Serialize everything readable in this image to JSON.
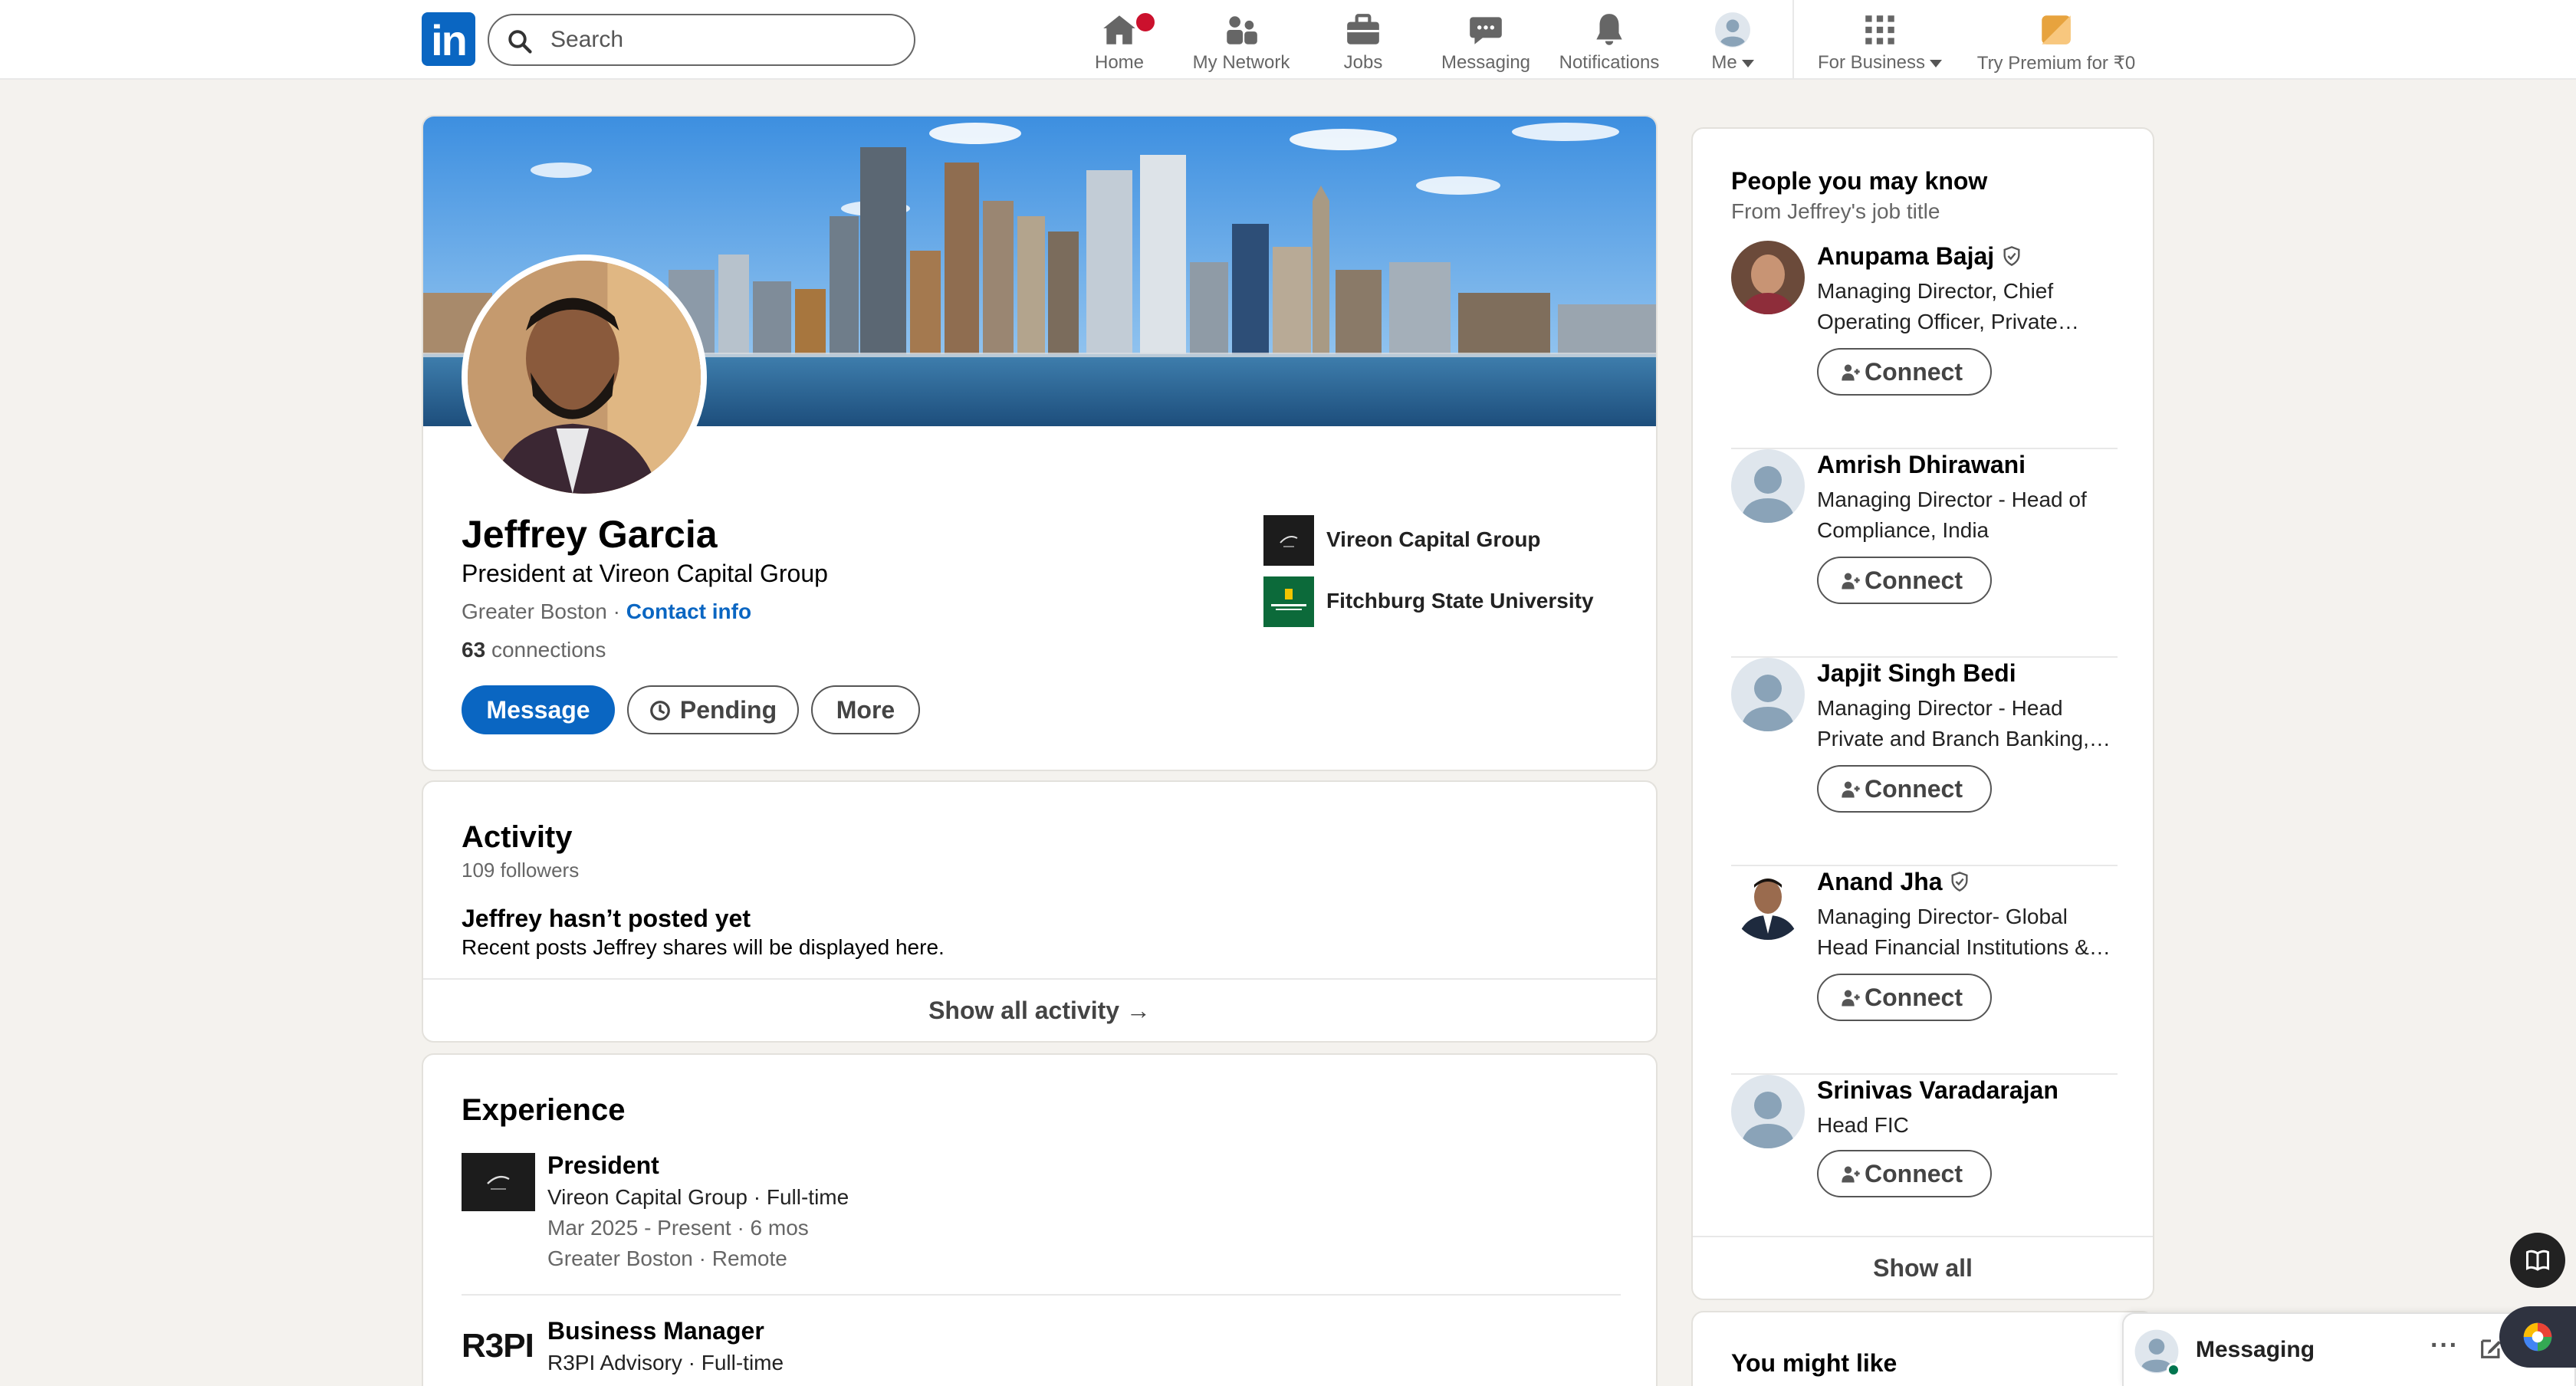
{
  "nav": {
    "logo": "in",
    "search_placeholder": "Search",
    "items": [
      {
        "label": "Home"
      },
      {
        "label": "My Network"
      },
      {
        "label": "Jobs"
      },
      {
        "label": "Messaging"
      },
      {
        "label": "Notifications"
      },
      {
        "label": "Me"
      },
      {
        "label": "For Business"
      },
      {
        "label": "Try Premium for ₹0"
      }
    ]
  },
  "profile": {
    "name": "Jeffrey Garcia",
    "headline": "President at Vireon Capital Group",
    "location": "Greater Boston",
    "separator": "·",
    "contact_info": "Contact info",
    "connections_count": "63",
    "connections_label": "connections",
    "buttons": {
      "message": "Message",
      "pending": "Pending",
      "more": "More"
    },
    "orgs": [
      {
        "name": "Vireon Capital Group"
      },
      {
        "name": "Fitchburg State University"
      }
    ]
  },
  "activity": {
    "title": "Activity",
    "followers": "109 followers",
    "empty_title": "Jeffrey hasn’t posted yet",
    "empty_desc": "Recent posts Jeffrey shares will be displayed here.",
    "show_all": "Show all activity →"
  },
  "experience": {
    "title": "Experience",
    "items": [
      {
        "title": "President",
        "company": "Vireon Capital Group · Full-time",
        "dates": "Mar 2025 - Present · 6 mos",
        "location": "Greater Boston · Remote"
      },
      {
        "title": "Business Manager",
        "company": "R3PI Advisory · Full-time",
        "logo_text": "R3PI"
      }
    ]
  },
  "pymk": {
    "title": "People you may know",
    "subtitle": "From Jeffrey's job title",
    "connect_label": "Connect",
    "people": [
      {
        "name": "Anupama Bajaj",
        "desc": "Managing Director, Chief Operating Officer, Private…",
        "verified": true
      },
      {
        "name": "Amrish Dhirawani",
        "desc": "Managing Director - Head of Compliance, India",
        "verified": false
      },
      {
        "name": "Japjit Singh Bedi",
        "desc": "Managing Director - Head Private and Branch Banking,…",
        "verified": false
      },
      {
        "name": "Anand Jha",
        "desc": "Managing Director- Global Head Financial Institutions &…",
        "verified": true
      },
      {
        "name": "Srinivas Varadarajan",
        "desc": "Head FIC",
        "verified": false
      }
    ],
    "show_all": "Show all"
  },
  "you_might_like": {
    "title": "You might like"
  },
  "messaging": {
    "label": "Messaging"
  },
  "colors": {
    "brand": "#0a66c2",
    "background": "#f4f2ee",
    "badge": "#cb112d"
  }
}
